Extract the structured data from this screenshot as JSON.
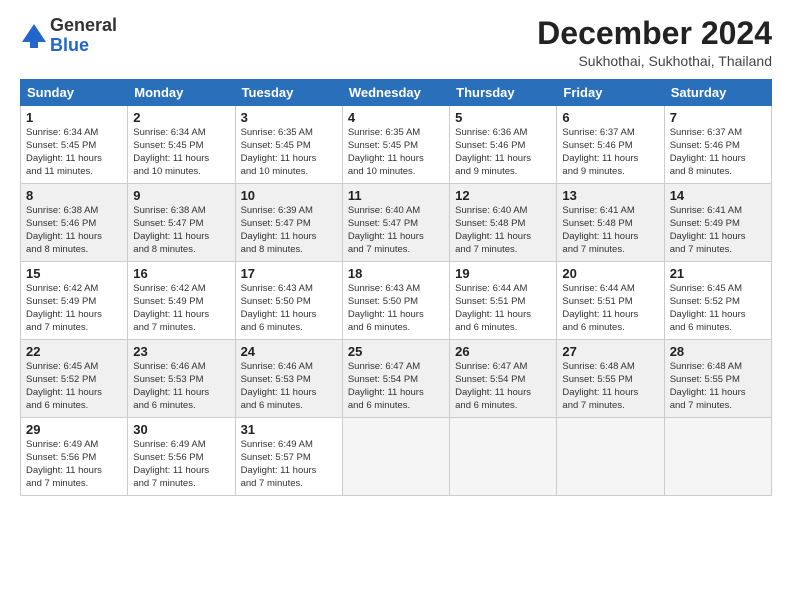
{
  "logo": {
    "general": "General",
    "blue": "Blue"
  },
  "header": {
    "month": "December 2024",
    "location": "Sukhothai, Sukhothai, Thailand"
  },
  "weekdays": [
    "Sunday",
    "Monday",
    "Tuesday",
    "Wednesday",
    "Thursday",
    "Friday",
    "Saturday"
  ],
  "weeks": [
    [
      {
        "day": "1",
        "detail": "Sunrise: 6:34 AM\nSunset: 5:45 PM\nDaylight: 11 hours\nand 11 minutes."
      },
      {
        "day": "2",
        "detail": "Sunrise: 6:34 AM\nSunset: 5:45 PM\nDaylight: 11 hours\nand 10 minutes."
      },
      {
        "day": "3",
        "detail": "Sunrise: 6:35 AM\nSunset: 5:45 PM\nDaylight: 11 hours\nand 10 minutes."
      },
      {
        "day": "4",
        "detail": "Sunrise: 6:35 AM\nSunset: 5:45 PM\nDaylight: 11 hours\nand 10 minutes."
      },
      {
        "day": "5",
        "detail": "Sunrise: 6:36 AM\nSunset: 5:46 PM\nDaylight: 11 hours\nand 9 minutes."
      },
      {
        "day": "6",
        "detail": "Sunrise: 6:37 AM\nSunset: 5:46 PM\nDaylight: 11 hours\nand 9 minutes."
      },
      {
        "day": "7",
        "detail": "Sunrise: 6:37 AM\nSunset: 5:46 PM\nDaylight: 11 hours\nand 8 minutes."
      }
    ],
    [
      {
        "day": "8",
        "detail": "Sunrise: 6:38 AM\nSunset: 5:46 PM\nDaylight: 11 hours\nand 8 minutes."
      },
      {
        "day": "9",
        "detail": "Sunrise: 6:38 AM\nSunset: 5:47 PM\nDaylight: 11 hours\nand 8 minutes."
      },
      {
        "day": "10",
        "detail": "Sunrise: 6:39 AM\nSunset: 5:47 PM\nDaylight: 11 hours\nand 8 minutes."
      },
      {
        "day": "11",
        "detail": "Sunrise: 6:40 AM\nSunset: 5:47 PM\nDaylight: 11 hours\nand 7 minutes."
      },
      {
        "day": "12",
        "detail": "Sunrise: 6:40 AM\nSunset: 5:48 PM\nDaylight: 11 hours\nand 7 minutes."
      },
      {
        "day": "13",
        "detail": "Sunrise: 6:41 AM\nSunset: 5:48 PM\nDaylight: 11 hours\nand 7 minutes."
      },
      {
        "day": "14",
        "detail": "Sunrise: 6:41 AM\nSunset: 5:49 PM\nDaylight: 11 hours\nand 7 minutes."
      }
    ],
    [
      {
        "day": "15",
        "detail": "Sunrise: 6:42 AM\nSunset: 5:49 PM\nDaylight: 11 hours\nand 7 minutes."
      },
      {
        "day": "16",
        "detail": "Sunrise: 6:42 AM\nSunset: 5:49 PM\nDaylight: 11 hours\nand 7 minutes."
      },
      {
        "day": "17",
        "detail": "Sunrise: 6:43 AM\nSunset: 5:50 PM\nDaylight: 11 hours\nand 6 minutes."
      },
      {
        "day": "18",
        "detail": "Sunrise: 6:43 AM\nSunset: 5:50 PM\nDaylight: 11 hours\nand 6 minutes."
      },
      {
        "day": "19",
        "detail": "Sunrise: 6:44 AM\nSunset: 5:51 PM\nDaylight: 11 hours\nand 6 minutes."
      },
      {
        "day": "20",
        "detail": "Sunrise: 6:44 AM\nSunset: 5:51 PM\nDaylight: 11 hours\nand 6 minutes."
      },
      {
        "day": "21",
        "detail": "Sunrise: 6:45 AM\nSunset: 5:52 PM\nDaylight: 11 hours\nand 6 minutes."
      }
    ],
    [
      {
        "day": "22",
        "detail": "Sunrise: 6:45 AM\nSunset: 5:52 PM\nDaylight: 11 hours\nand 6 minutes."
      },
      {
        "day": "23",
        "detail": "Sunrise: 6:46 AM\nSunset: 5:53 PM\nDaylight: 11 hours\nand 6 minutes."
      },
      {
        "day": "24",
        "detail": "Sunrise: 6:46 AM\nSunset: 5:53 PM\nDaylight: 11 hours\nand 6 minutes."
      },
      {
        "day": "25",
        "detail": "Sunrise: 6:47 AM\nSunset: 5:54 PM\nDaylight: 11 hours\nand 6 minutes."
      },
      {
        "day": "26",
        "detail": "Sunrise: 6:47 AM\nSunset: 5:54 PM\nDaylight: 11 hours\nand 6 minutes."
      },
      {
        "day": "27",
        "detail": "Sunrise: 6:48 AM\nSunset: 5:55 PM\nDaylight: 11 hours\nand 7 minutes."
      },
      {
        "day": "28",
        "detail": "Sunrise: 6:48 AM\nSunset: 5:55 PM\nDaylight: 11 hours\nand 7 minutes."
      }
    ],
    [
      {
        "day": "29",
        "detail": "Sunrise: 6:49 AM\nSunset: 5:56 PM\nDaylight: 11 hours\nand 7 minutes."
      },
      {
        "day": "30",
        "detail": "Sunrise: 6:49 AM\nSunset: 5:56 PM\nDaylight: 11 hours\nand 7 minutes."
      },
      {
        "day": "31",
        "detail": "Sunrise: 6:49 AM\nSunset: 5:57 PM\nDaylight: 11 hours\nand 7 minutes."
      },
      {
        "day": "",
        "detail": ""
      },
      {
        "day": "",
        "detail": ""
      },
      {
        "day": "",
        "detail": ""
      },
      {
        "day": "",
        "detail": ""
      }
    ]
  ]
}
